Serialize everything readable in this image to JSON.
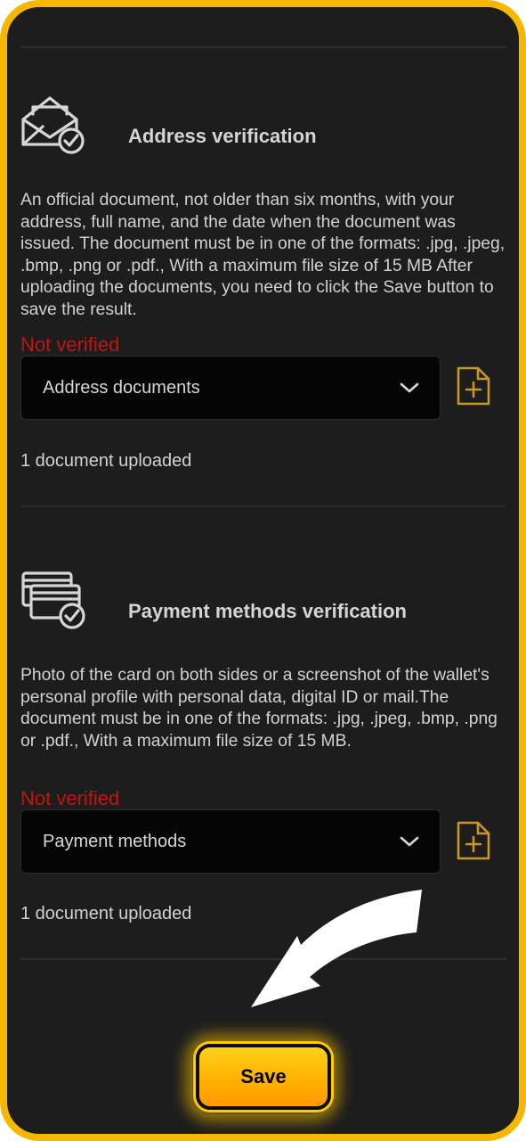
{
  "sections": [
    {
      "id": "address",
      "title": "Address verification",
      "icon": "envelope-check-icon",
      "description": "An official document, not older than six months, with your address, full name, and the date when the document was issued. The document must be in one of the formats: .jpg, .jpeg, .bmp, .png or .pdf., With a maximum file size of 15 MB After uploading the documents, you need to click the Save button to save the result.",
      "status": "Not verified",
      "select_value": "Address documents",
      "uploaded_text": "1 document uploaded"
    },
    {
      "id": "payment",
      "title": "Payment methods verification",
      "icon": "cards-check-icon",
      "description": "Photo of the card on both sides or a screenshot of the wallet's personal profile with personal data, digital ID or mail.The document must be in one of the formats: .jpg, .jpeg, .bmp, .png or .pdf., With a maximum file size of 15 MB.",
      "status": "Not verified",
      "select_value": "Payment methods",
      "uploaded_text": "1 document uploaded"
    }
  ],
  "save_label": "Save",
  "colors": {
    "frame_border": "#f5b800",
    "background": "#1d1d1d",
    "status_red": "#c0160e",
    "accent_gold": "#c9962a",
    "button_yellow": "#ffb100"
  }
}
